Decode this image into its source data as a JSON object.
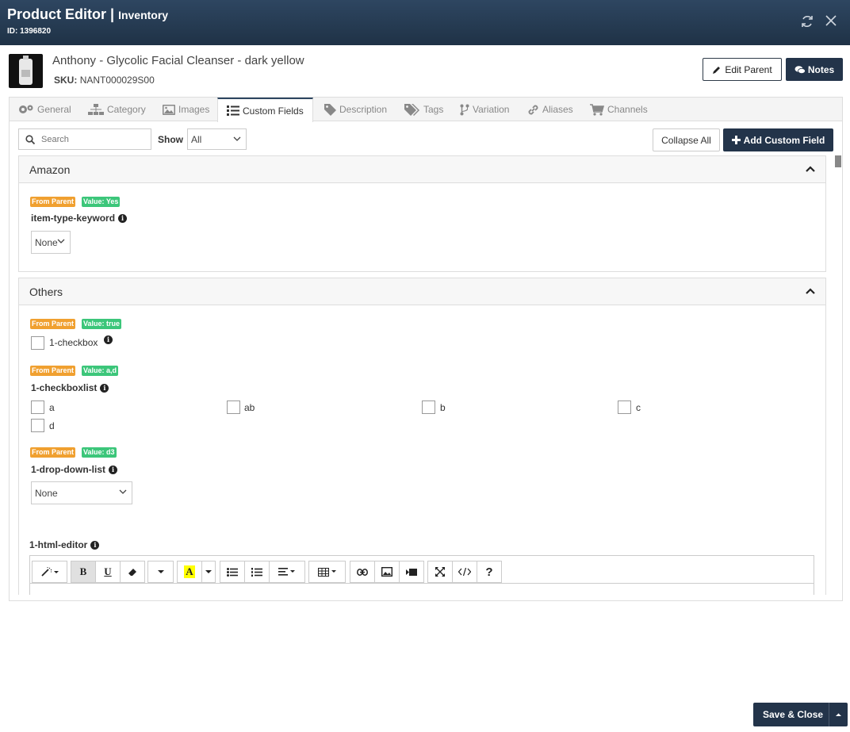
{
  "header": {
    "title": "Product Editor",
    "separator": "|",
    "subtitle": "Inventory",
    "id_text": "ID: 1396820"
  },
  "product": {
    "name": "Anthony - Glycolic Facial Cleanser - dark yellow",
    "sku_label": "SKU:",
    "sku_value": "NANT000029S00"
  },
  "actions": {
    "edit_parent": "Edit Parent",
    "notes": "Notes"
  },
  "tabs": [
    {
      "label": "General",
      "icon": "gears-icon"
    },
    {
      "label": "Category",
      "icon": "sitemap-icon"
    },
    {
      "label": "Images",
      "icon": "image-icon"
    },
    {
      "label": "Custom Fields",
      "icon": "list-icon",
      "active": true
    },
    {
      "label": "Description",
      "icon": "tag-icon"
    },
    {
      "label": "Tags",
      "icon": "tags-icon"
    },
    {
      "label": "Variation",
      "icon": "branch-icon"
    },
    {
      "label": "Aliases",
      "icon": "link-icon"
    },
    {
      "label": "Channels",
      "icon": "cart-icon"
    }
  ],
  "toolbar": {
    "search_placeholder": "Search",
    "show_label": "Show",
    "show_value": "All",
    "collapse_all": "Collapse All",
    "add_custom_field": "Add Custom Field"
  },
  "sections": {
    "amazon": {
      "title": "Amazon",
      "field": {
        "badge_parent": "From Parent",
        "badge_value": "Value: Yes",
        "label": "item-type-keyword",
        "select_value": "None"
      }
    },
    "others": {
      "title": "Others",
      "checkbox_field": {
        "badge_parent": "From Parent",
        "badge_value": "Value: true",
        "label": "1-checkbox"
      },
      "checkboxlist_field": {
        "badge_parent": "From Parent",
        "badge_value": "Value: a,d",
        "label": "1-checkboxlist",
        "options": [
          "a",
          "ab",
          "b",
          "c",
          "d"
        ]
      },
      "dropdown_field": {
        "badge_parent": "From Parent",
        "badge_value": "Value: d3",
        "label": "1-drop-down-list",
        "select_value": "None"
      },
      "html_editor": {
        "label": "1-html-editor"
      }
    }
  },
  "footer": {
    "save_close": "Save & Close"
  },
  "colors": {
    "header_bg": "#23344a",
    "badge_orange": "#f0a030",
    "badge_green": "#3cc67a"
  }
}
